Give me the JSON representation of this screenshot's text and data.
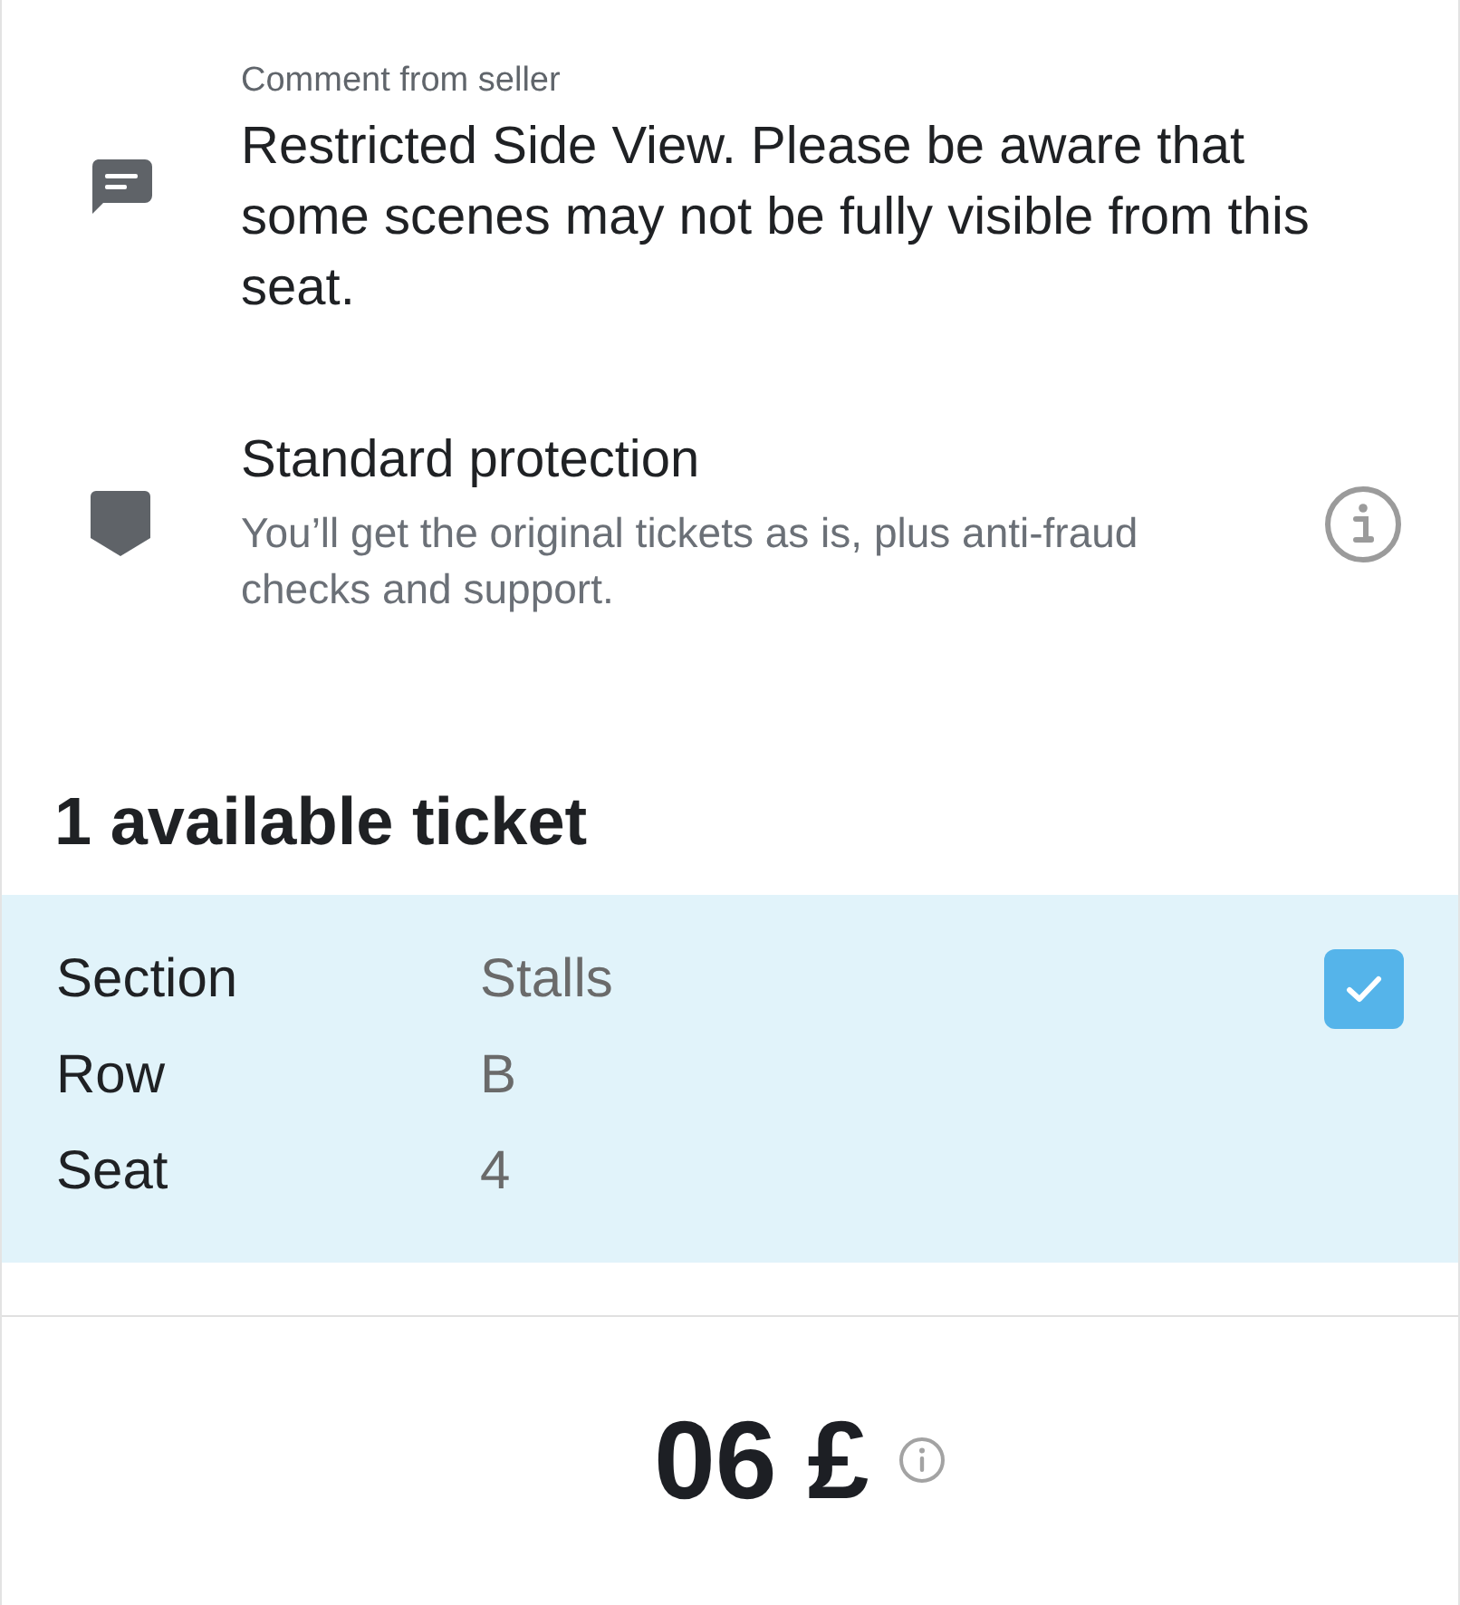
{
  "comment": {
    "label": "Comment from seller",
    "text": "Restricted Side View. Please be aware that some scenes may not be fully visible from this seat."
  },
  "protection": {
    "title": "Standard protection",
    "description": "You’ll get the original tickets as is, plus anti-fraud checks and support."
  },
  "tickets": {
    "heading": "1 available ticket",
    "items": [
      {
        "checked": true,
        "details": [
          {
            "label": "Section",
            "value": "Stalls"
          },
          {
            "label": "Row",
            "value": "B"
          },
          {
            "label": "Seat",
            "value": "4"
          }
        ]
      }
    ]
  },
  "price": {
    "amount": "06 £"
  }
}
